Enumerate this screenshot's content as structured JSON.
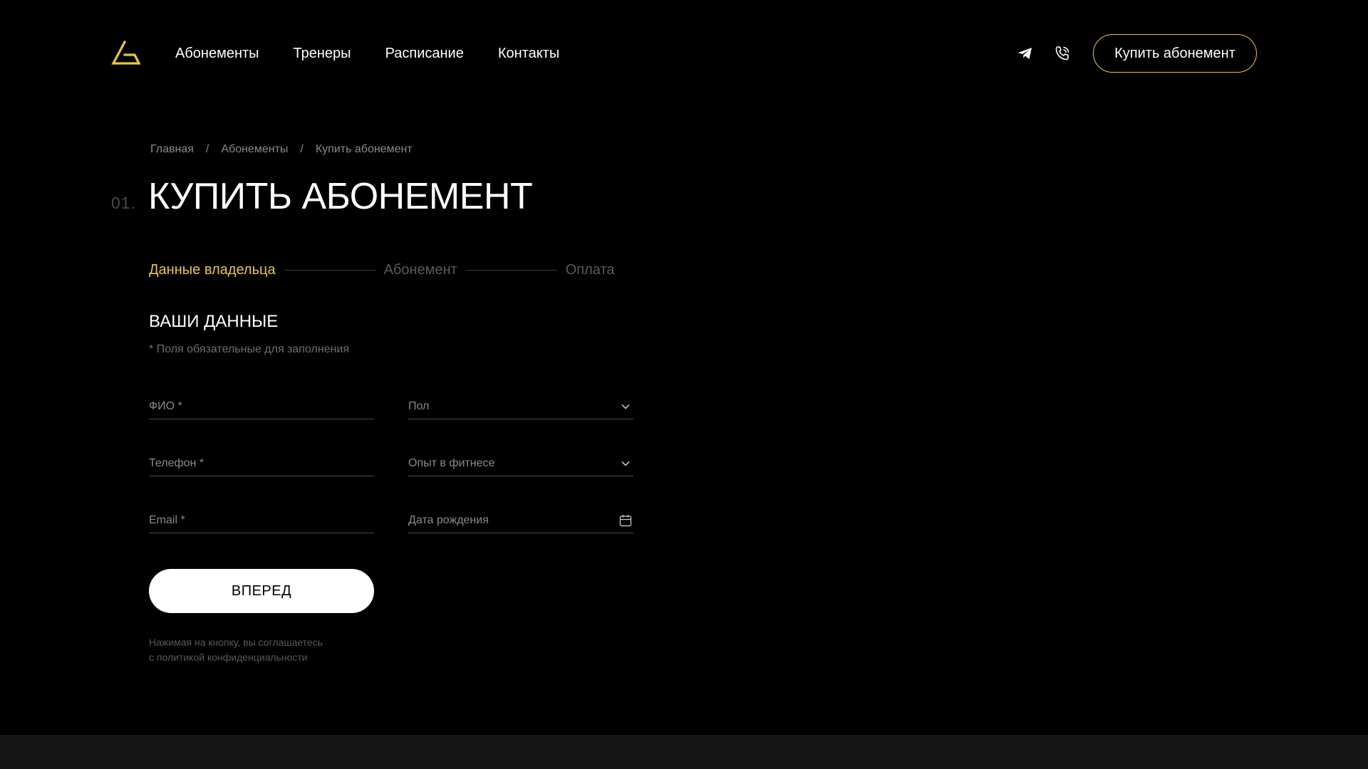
{
  "nav": {
    "items": [
      "Абонементы",
      "Тренеры",
      "Расписание",
      "Контакты"
    ]
  },
  "header": {
    "icons": [
      "telegram-icon",
      "phone-icon"
    ],
    "buy_button": "Купить абонемент"
  },
  "breadcrumb": {
    "items": [
      "Главная",
      "Абонементы",
      "Купить абонемент"
    ],
    "separator": "/"
  },
  "page": {
    "number": "01.",
    "title": "КУПИТЬ АБОНЕМЕНТ"
  },
  "steps": {
    "items": [
      "Данные владельца",
      "Абонемент",
      "Оплата"
    ],
    "active_index": 0
  },
  "form": {
    "section_title": "ВАШИ ДАННЫЕ",
    "required_note": "* Поля обязательные для заполнения",
    "fields": {
      "full_name": {
        "placeholder": "ФИО *",
        "value": ""
      },
      "gender": {
        "placeholder": "Пол"
      },
      "phone": {
        "placeholder": "Телефон *",
        "value": ""
      },
      "fitness_experience": {
        "placeholder": "Опыт в фитнесе"
      },
      "email": {
        "placeholder": "Email *",
        "value": ""
      },
      "birth_date": {
        "placeholder": "Дата рождения"
      }
    },
    "submit_label": "ВПЕРЕД",
    "consent_line1": "Нажимая на кнопку, вы соглашаетесь",
    "consent_line2": "с политикой конфиденциальности"
  },
  "colors": {
    "accent": "#e8c547",
    "background": "#000000",
    "muted": "#8a8a8a"
  }
}
